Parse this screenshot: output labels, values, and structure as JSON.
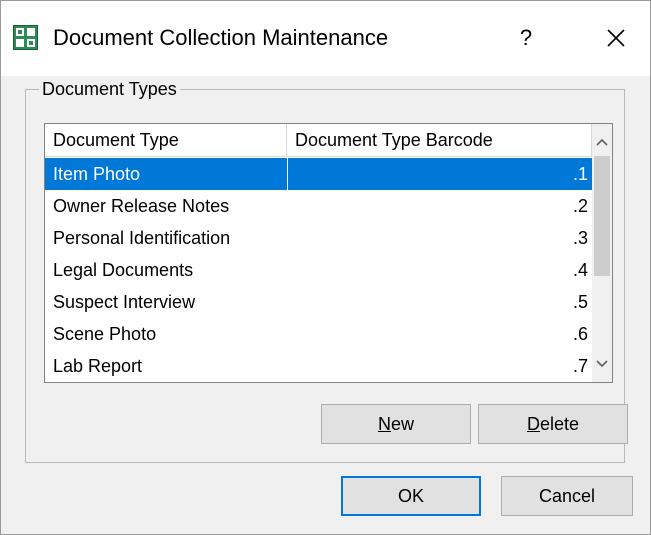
{
  "window": {
    "title": "Document Collection Maintenance",
    "help_label": "?",
    "icon": "app-grid-icon",
    "accent_color": "#0078d7"
  },
  "group": {
    "label": "Document Types"
  },
  "list": {
    "columns": [
      "Document Type",
      "Document Type Barcode"
    ],
    "rows": [
      {
        "type": "Item Photo",
        "barcode": ".1",
        "selected": true
      },
      {
        "type": "Owner Release Notes",
        "barcode": ".2"
      },
      {
        "type": "Personal Identification",
        "barcode": ".3"
      },
      {
        "type": "Legal Documents",
        "barcode": ".4"
      },
      {
        "type": "Suspect Interview",
        "barcode": ".5"
      },
      {
        "type": "Scene Photo",
        "barcode": ".6"
      },
      {
        "type": "Lab Report",
        "barcode": ".7"
      }
    ]
  },
  "buttons": {
    "new_first": "N",
    "new_rest": "ew",
    "delete_first": "D",
    "delete_rest": "elete",
    "ok": "OK",
    "cancel": "Cancel"
  }
}
